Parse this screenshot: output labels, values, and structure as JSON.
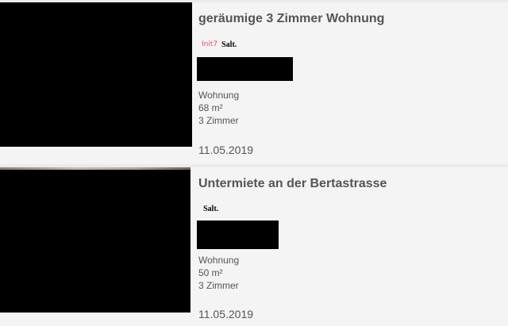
{
  "listings": [
    {
      "title": "geräumige 3 Zimmer Wohnung",
      "logos": [
        "Init7",
        "Salt."
      ],
      "type": "Wohnung",
      "area": "68 m²",
      "rooms": "3 Zimmer",
      "date": "11.05.2019"
    },
    {
      "title": "Untermiete an der Bertastrasse",
      "logos": [
        "Salt."
      ],
      "type": "Wohnung",
      "area": "50 m²",
      "rooms": "3 Zimmer",
      "date": "11.05.2019"
    }
  ],
  "colors": {
    "init7_logo": "#e2495f",
    "text": "#555555",
    "card_background": "#f4f4f4",
    "page_background": "#ebebeb"
  }
}
